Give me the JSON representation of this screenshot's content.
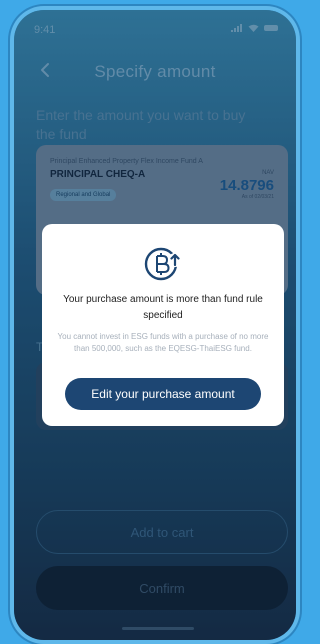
{
  "status_bar": {
    "time": "9:41"
  },
  "header": {
    "title": "Specify amount"
  },
  "instruction": "Enter the amount you want to buy the fund",
  "fund_card": {
    "full_name": "Principal Enhanced Property Flex Income Fund A",
    "code": "PRINCIPAL CHEQ-A",
    "tag": "Regional and Global",
    "nav_label": "NAV",
    "nav_value": "14.8796",
    "nav_date": "As of 02/03/21"
  },
  "section_label": "T",
  "buttons": {
    "add_to_cart": "Add to cart",
    "confirm": "Confirm"
  },
  "modal": {
    "title": "Your purchase amount is more than fund rule specified",
    "description": "You cannot invest in ESG funds with a purchase of no more than 500,000, such as the EQESG-ThaiESG fund.",
    "action_label": "Edit your purchase amount",
    "icon": "baht-coin-upload-icon",
    "accent_color": "#1d4673"
  }
}
